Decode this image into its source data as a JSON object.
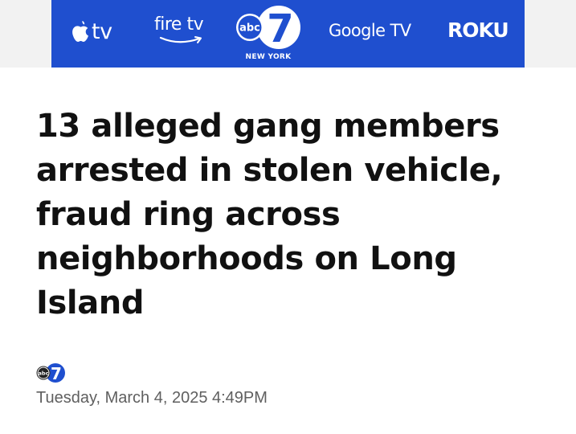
{
  "header": {
    "brands": {
      "apple_tv": {
        "icon": "apple-logo-icon",
        "text": "tv"
      },
      "fire_tv": {
        "text": "fire tv"
      },
      "station": {
        "logo_text": "abc",
        "channel": "7",
        "city": "NEW YORK"
      },
      "google_tv": {
        "text": "Google TV"
      },
      "roku": {
        "text": "ROKU"
      }
    },
    "colors": {
      "banner": "#1f4fcf",
      "strip": "#f2f2f2"
    }
  },
  "article": {
    "headline": "13 alleged gang members arrested in stolen vehicle, fraud ring across neighborhoods on Long Island",
    "byline_logo": "abc7-logo-icon",
    "timestamp": "Tuesday, March 4, 2025 4:49PM"
  }
}
